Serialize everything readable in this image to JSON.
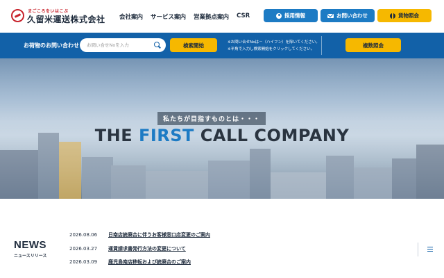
{
  "header": {
    "logo_tagline": "まごころをいはこぶ",
    "logo_name": "久留米運送株式会社",
    "nav": [
      "会社案内",
      "サービス案内",
      "営業拠点案内",
      "CSR"
    ],
    "buttons": {
      "recruit": "採用情報",
      "contact": "お問い合わせ",
      "tracking": "貨物照会"
    }
  },
  "inquiry": {
    "title": "お荷物のお問い合わせ",
    "search_placeholder": "お問い合せNoを入力",
    "search_button": "検索開始",
    "note_line1": "※お問い合せNoは－（ハイフン）を除いてください。",
    "note_line2": "※半角で入力し検索開始をクリックしてください。",
    "multi_button": "複数照会"
  },
  "hero": {
    "subtitle": "私たちが目指すものとは・・・",
    "title_pre": "THE ",
    "title_accent": "FIRST",
    "title_post": " CALL COMPANY"
  },
  "news": {
    "heading": "NEWS",
    "subheading": "ニュースリリース",
    "items": [
      {
        "date": "2026.08.06",
        "title": "日南店統廃合に伴うお客様窓口店変更のご案内"
      },
      {
        "date": "2026.03.27",
        "title": "運賃請求書発行方法の変更について"
      },
      {
        "date": "2026.03.09",
        "title": "鹿児島南店移転および統廃合のご案内"
      }
    ]
  },
  "colors": {
    "primary_blue": "#1261a8",
    "button_blue": "#1d7bc4",
    "accent_yellow": "#f6b800",
    "brand_red": "#c8232c",
    "text_dark": "#1e2b3c"
  },
  "icons": [
    "logo-mark-icon",
    "person-icon",
    "mail-icon",
    "globe-icon",
    "search-icon",
    "menu-icon"
  ]
}
